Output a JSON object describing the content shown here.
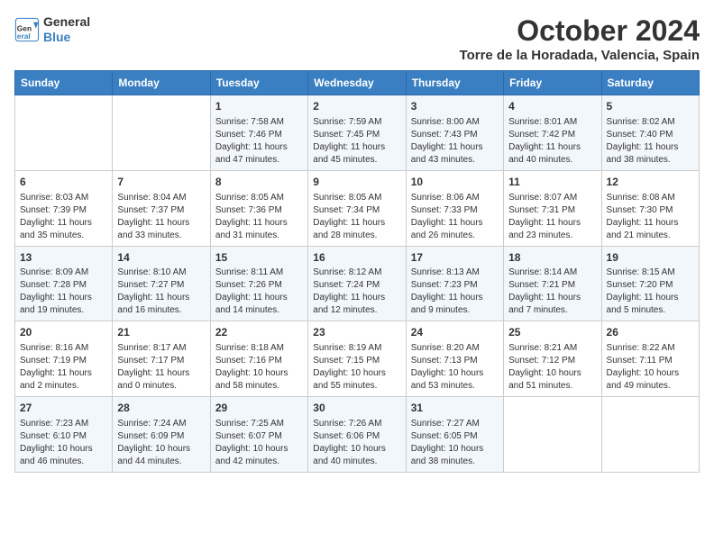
{
  "header": {
    "logo_line1": "General",
    "logo_line2": "Blue",
    "month": "October 2024",
    "location": "Torre de la Horadada, Valencia, Spain"
  },
  "days_of_week": [
    "Sunday",
    "Monday",
    "Tuesday",
    "Wednesday",
    "Thursday",
    "Friday",
    "Saturday"
  ],
  "weeks": [
    [
      {
        "day": "",
        "info": ""
      },
      {
        "day": "",
        "info": ""
      },
      {
        "day": "1",
        "info": "Sunrise: 7:58 AM\nSunset: 7:46 PM\nDaylight: 11 hours and 47 minutes."
      },
      {
        "day": "2",
        "info": "Sunrise: 7:59 AM\nSunset: 7:45 PM\nDaylight: 11 hours and 45 minutes."
      },
      {
        "day": "3",
        "info": "Sunrise: 8:00 AM\nSunset: 7:43 PM\nDaylight: 11 hours and 43 minutes."
      },
      {
        "day": "4",
        "info": "Sunrise: 8:01 AM\nSunset: 7:42 PM\nDaylight: 11 hours and 40 minutes."
      },
      {
        "day": "5",
        "info": "Sunrise: 8:02 AM\nSunset: 7:40 PM\nDaylight: 11 hours and 38 minutes."
      }
    ],
    [
      {
        "day": "6",
        "info": "Sunrise: 8:03 AM\nSunset: 7:39 PM\nDaylight: 11 hours and 35 minutes."
      },
      {
        "day": "7",
        "info": "Sunrise: 8:04 AM\nSunset: 7:37 PM\nDaylight: 11 hours and 33 minutes."
      },
      {
        "day": "8",
        "info": "Sunrise: 8:05 AM\nSunset: 7:36 PM\nDaylight: 11 hours and 31 minutes."
      },
      {
        "day": "9",
        "info": "Sunrise: 8:05 AM\nSunset: 7:34 PM\nDaylight: 11 hours and 28 minutes."
      },
      {
        "day": "10",
        "info": "Sunrise: 8:06 AM\nSunset: 7:33 PM\nDaylight: 11 hours and 26 minutes."
      },
      {
        "day": "11",
        "info": "Sunrise: 8:07 AM\nSunset: 7:31 PM\nDaylight: 11 hours and 23 minutes."
      },
      {
        "day": "12",
        "info": "Sunrise: 8:08 AM\nSunset: 7:30 PM\nDaylight: 11 hours and 21 minutes."
      }
    ],
    [
      {
        "day": "13",
        "info": "Sunrise: 8:09 AM\nSunset: 7:28 PM\nDaylight: 11 hours and 19 minutes."
      },
      {
        "day": "14",
        "info": "Sunrise: 8:10 AM\nSunset: 7:27 PM\nDaylight: 11 hours and 16 minutes."
      },
      {
        "day": "15",
        "info": "Sunrise: 8:11 AM\nSunset: 7:26 PM\nDaylight: 11 hours and 14 minutes."
      },
      {
        "day": "16",
        "info": "Sunrise: 8:12 AM\nSunset: 7:24 PM\nDaylight: 11 hours and 12 minutes."
      },
      {
        "day": "17",
        "info": "Sunrise: 8:13 AM\nSunset: 7:23 PM\nDaylight: 11 hours and 9 minutes."
      },
      {
        "day": "18",
        "info": "Sunrise: 8:14 AM\nSunset: 7:21 PM\nDaylight: 11 hours and 7 minutes."
      },
      {
        "day": "19",
        "info": "Sunrise: 8:15 AM\nSunset: 7:20 PM\nDaylight: 11 hours and 5 minutes."
      }
    ],
    [
      {
        "day": "20",
        "info": "Sunrise: 8:16 AM\nSunset: 7:19 PM\nDaylight: 11 hours and 2 minutes."
      },
      {
        "day": "21",
        "info": "Sunrise: 8:17 AM\nSunset: 7:17 PM\nDaylight: 11 hours and 0 minutes."
      },
      {
        "day": "22",
        "info": "Sunrise: 8:18 AM\nSunset: 7:16 PM\nDaylight: 10 hours and 58 minutes."
      },
      {
        "day": "23",
        "info": "Sunrise: 8:19 AM\nSunset: 7:15 PM\nDaylight: 10 hours and 55 minutes."
      },
      {
        "day": "24",
        "info": "Sunrise: 8:20 AM\nSunset: 7:13 PM\nDaylight: 10 hours and 53 minutes."
      },
      {
        "day": "25",
        "info": "Sunrise: 8:21 AM\nSunset: 7:12 PM\nDaylight: 10 hours and 51 minutes."
      },
      {
        "day": "26",
        "info": "Sunrise: 8:22 AM\nSunset: 7:11 PM\nDaylight: 10 hours and 49 minutes."
      }
    ],
    [
      {
        "day": "27",
        "info": "Sunrise: 7:23 AM\nSunset: 6:10 PM\nDaylight: 10 hours and 46 minutes."
      },
      {
        "day": "28",
        "info": "Sunrise: 7:24 AM\nSunset: 6:09 PM\nDaylight: 10 hours and 44 minutes."
      },
      {
        "day": "29",
        "info": "Sunrise: 7:25 AM\nSunset: 6:07 PM\nDaylight: 10 hours and 42 minutes."
      },
      {
        "day": "30",
        "info": "Sunrise: 7:26 AM\nSunset: 6:06 PM\nDaylight: 10 hours and 40 minutes."
      },
      {
        "day": "31",
        "info": "Sunrise: 7:27 AM\nSunset: 6:05 PM\nDaylight: 10 hours and 38 minutes."
      },
      {
        "day": "",
        "info": ""
      },
      {
        "day": "",
        "info": ""
      }
    ]
  ]
}
